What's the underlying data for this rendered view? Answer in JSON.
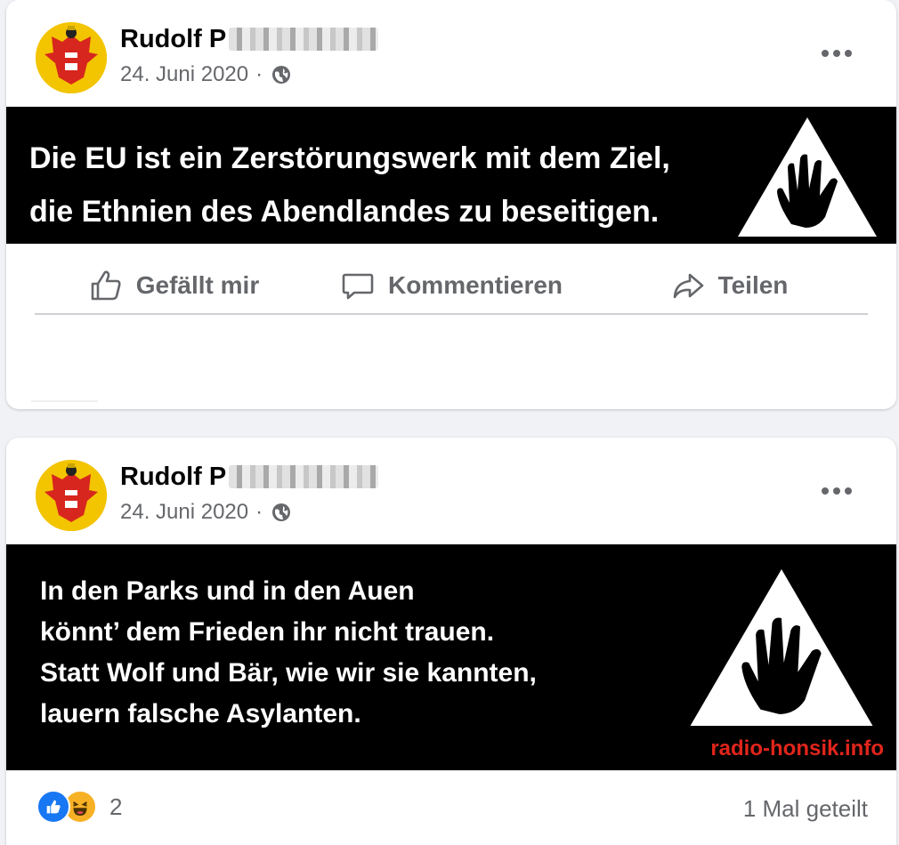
{
  "posts": [
    {
      "author": "Rudolf P",
      "date": "24. Juni 2020",
      "separator": "·",
      "privacy_icon": "globe-icon",
      "more_icon": "more-horizontal-icon",
      "image_text": [
        "Die EU ist ein Zerstörungswerk mit dem Ziel,",
        "die Ethnien des Abendlandes zu beseitigen."
      ],
      "actions": [
        {
          "label": "Gefällt mir",
          "icon": "thumbs-up-icon"
        },
        {
          "label": "Kommentieren",
          "icon": "comment-icon"
        },
        {
          "label": "Teilen",
          "icon": "share-icon"
        }
      ]
    },
    {
      "author": "Rudolf P",
      "date": "24. Juni 2020",
      "separator": "·",
      "privacy_icon": "globe-icon",
      "more_icon": "more-horizontal-icon",
      "image_text": [
        "In den Parks und in den Auen",
        "könnt’ dem Frieden ihr nicht trauen.",
        "Statt Wolf und Bär, wie wir sie kannten,",
        "lauern falsche Asylanten."
      ],
      "image_watermark": "radio-honsik.info",
      "reactions": {
        "icons": [
          "like-reaction-icon",
          "haha-reaction-icon"
        ],
        "count": "2"
      },
      "shares": "1 Mal geteilt"
    }
  ],
  "colors": {
    "page_bg": "#f0f2f5",
    "card_bg": "#ffffff",
    "text_primary": "#050505",
    "text_secondary": "#65676b",
    "like_blue": "#1877f2",
    "watermark_red": "#e1251b"
  }
}
